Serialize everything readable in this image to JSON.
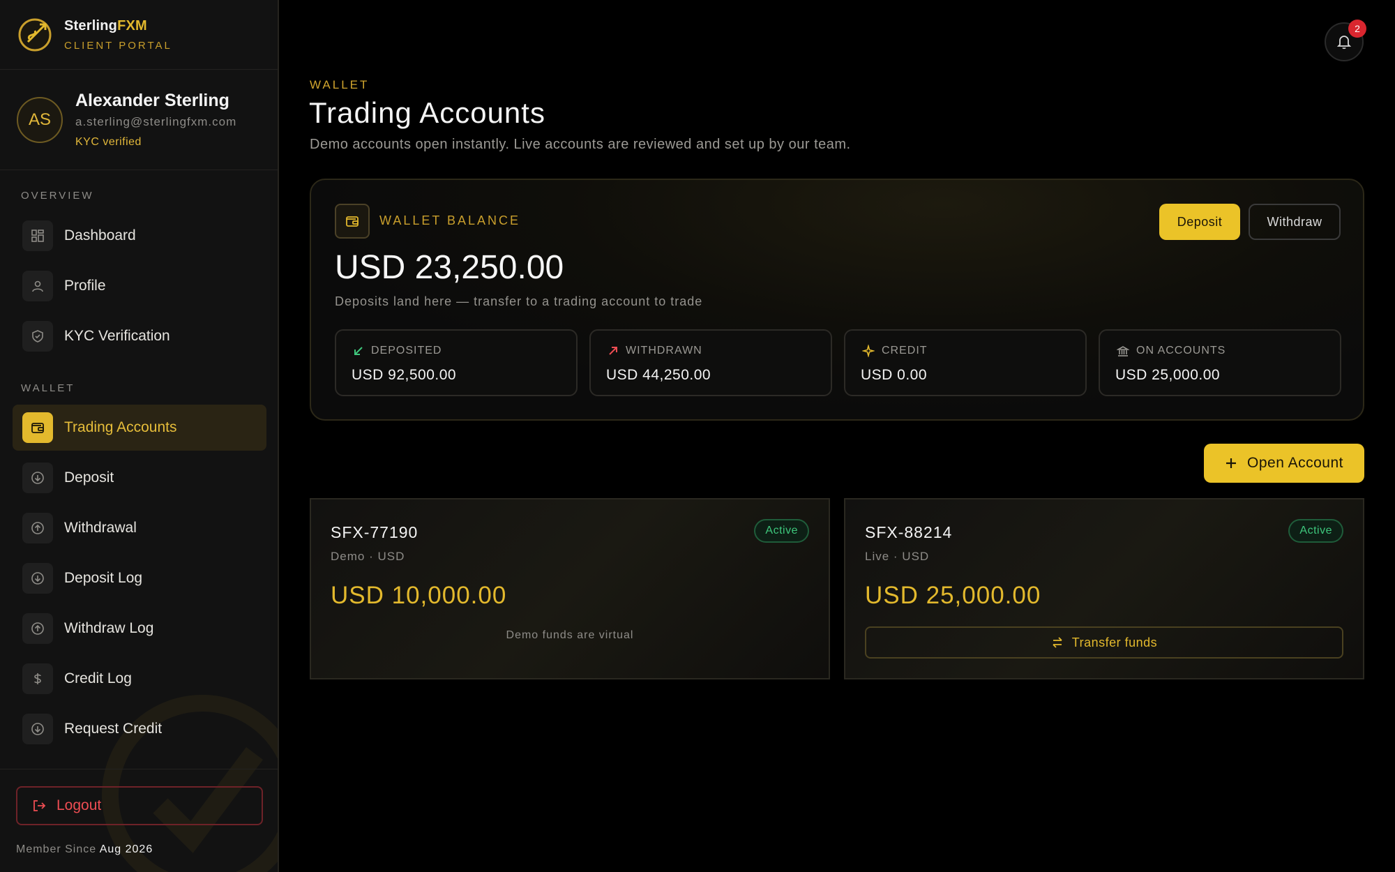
{
  "brand": {
    "name_a": "Sterling",
    "name_b": "FXM",
    "subtitle": "CLIENT PORTAL"
  },
  "user": {
    "initials": "AS",
    "name": "Alexander Sterling",
    "email": "a.sterling@sterlingfxm.com",
    "kyc": "KYC verified"
  },
  "sidebar": {
    "sections": {
      "overview": "OVERVIEW",
      "wallet": "WALLET"
    },
    "items": [
      {
        "label": "Dashboard",
        "icon": "dashboard-icon"
      },
      {
        "label": "Profile",
        "icon": "user-icon"
      },
      {
        "label": "KYC Verification",
        "icon": "shield-icon"
      },
      {
        "label": "Trading Accounts",
        "icon": "wallet-icon",
        "active": true
      },
      {
        "label": "Deposit",
        "icon": "arrow-down-circle-icon"
      },
      {
        "label": "Withdrawal",
        "icon": "arrow-up-circle-icon"
      },
      {
        "label": "Deposit Log",
        "icon": "arrow-down-circle-icon"
      },
      {
        "label": "Withdraw Log",
        "icon": "arrow-up-circle-icon"
      },
      {
        "label": "Credit Log",
        "icon": "dollar-icon"
      },
      {
        "label": "Request Credit",
        "icon": "arrow-down-circle-icon"
      }
    ],
    "logout": "Logout",
    "member_label": "Member Since",
    "member_date": "Aug 2026"
  },
  "notifications": {
    "count": "2"
  },
  "header": {
    "eyebrow": "WALLET",
    "title": "Trading Accounts",
    "description": "Demo accounts open instantly. Live accounts are reviewed and set up by our team."
  },
  "wallet": {
    "label": "WALLET BALANCE",
    "amount": "USD 23,250.00",
    "subtitle": "Deposits land here — transfer to a trading account to trade",
    "deposit_label": "Deposit",
    "withdraw_label": "Withdraw",
    "stats": [
      {
        "label": "DEPOSITED",
        "value": "USD 92,500.00",
        "icon": "arrow-down-left-icon",
        "color": "#3ec77c"
      },
      {
        "label": "WITHDRAWN",
        "value": "USD 44,250.00",
        "icon": "arrow-up-right-icon",
        "color": "#ee4d53"
      },
      {
        "label": "CREDIT",
        "value": "USD 0.00",
        "icon": "sparkle-icon",
        "color": "#e3b92d"
      },
      {
        "label": "ON ACCOUNTS",
        "value": "USD 25,000.00",
        "icon": "bank-icon",
        "color": "#9b9994"
      }
    ]
  },
  "open_account_label": "Open Account",
  "accounts": [
    {
      "id": "SFX-77190",
      "type": "Demo · USD",
      "status": "Active",
      "balance": "USD 10,000.00",
      "note": "Demo funds are virtual"
    },
    {
      "id": "SFX-88214",
      "type": "Live · USD",
      "status": "Active",
      "balance": "USD 25,000.00",
      "action": "Transfer funds"
    }
  ],
  "colors": {
    "accent": "#ebc328",
    "danger": "#ee4d53",
    "success": "#3ec77c",
    "background": "#000000"
  }
}
